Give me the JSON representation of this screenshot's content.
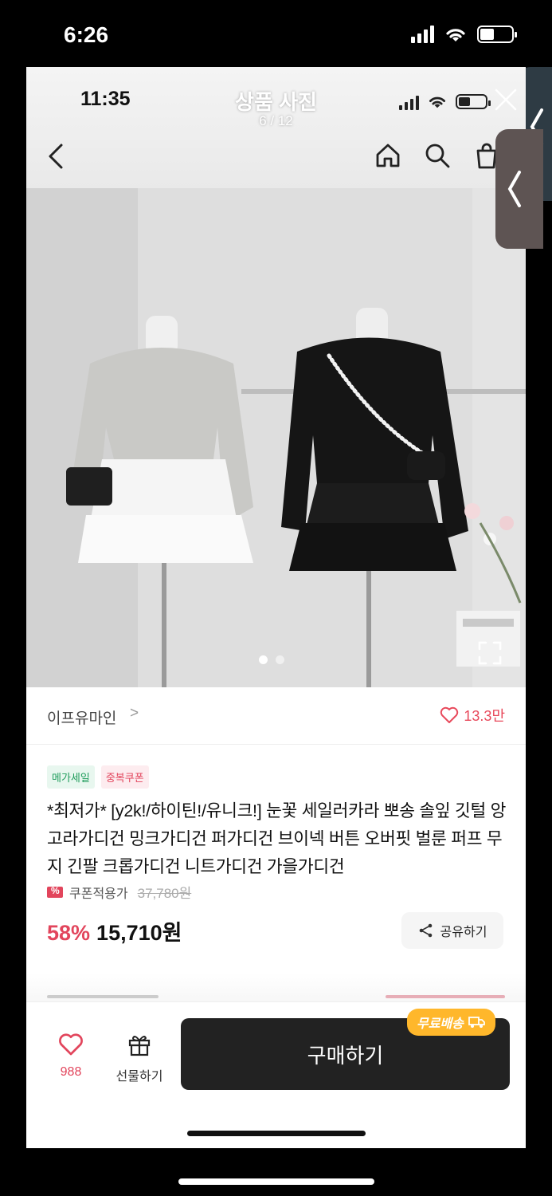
{
  "outer_status": {
    "time": "6:26",
    "battery_level": 0.45
  },
  "inner_status": {
    "time": "11:35",
    "battery_level": 0.4
  },
  "viewer": {
    "title": "상품 사진",
    "counter": "6 / 12"
  },
  "nav": {
    "icons": [
      "back-icon",
      "home-icon",
      "search-icon",
      "cart-icon"
    ]
  },
  "photo": {
    "dots_total": 2,
    "dots_active": 1
  },
  "seller": {
    "name": "이프유마인",
    "chevron": ">",
    "likes": "13.3만"
  },
  "badges": {
    "mega_sale": "메가세일",
    "double_coupon": "중복쿠폰"
  },
  "product": {
    "title": "*최저가* [y2k!/하이틴!/유니크!] 눈꽃 세일러카라 뽀송 솔잎 깃털 앙고라가디건 밍크가디건 퍼가디건 브이넥 버튼 오버핏 벌룬 퍼프 무지 긴팔 크롭가디건 니트가디건 가을가디건",
    "coupon_label": "쿠폰적용가",
    "original_price": "37,780원",
    "discount": "58%",
    "price": "15,710원",
    "share_label": "공유하기"
  },
  "bottom": {
    "wish_count": "988",
    "gift_label": "선물하기",
    "buy_label": "구매하기",
    "free_shipping": "무료배송"
  },
  "colors": {
    "accent": "#e2455c",
    "buy_bg": "#222222",
    "free_ship": "#ffb72b",
    "green": "#1e9c5b"
  }
}
